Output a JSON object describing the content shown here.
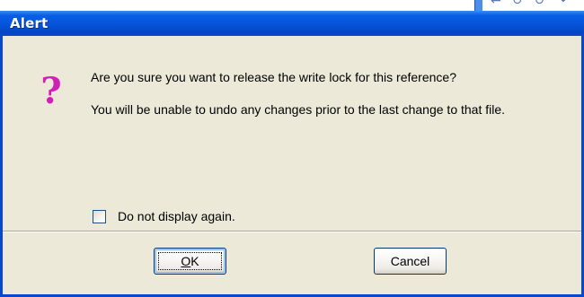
{
  "background": {
    "glyphs": "← ↺ ↻ ↷"
  },
  "dialog": {
    "title": "Alert",
    "icon": "question-icon",
    "icon_glyph": "?",
    "icon_color": "#d21fb8",
    "title_bar_color": "#0a5fe6",
    "body_color": "#ece9d8",
    "message_lines": [
      "Are you sure you want to release the write lock for this reference?",
      "You will be unable to undo any changes prior to the last change to that file."
    ],
    "checkbox": {
      "label": "Do not display again.",
      "checked": false
    },
    "buttons": {
      "ok": {
        "mnemonic": "O",
        "rest": "K",
        "default": true
      },
      "cancel": {
        "label": "Cancel"
      }
    }
  }
}
